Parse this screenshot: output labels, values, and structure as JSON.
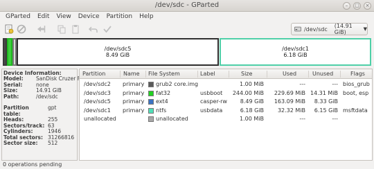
{
  "window": {
    "title": "/dev/sdc - GParted",
    "minimize": "–",
    "maximize": "▢",
    "close": "×"
  },
  "menu": [
    "GParted",
    "Edit",
    "View",
    "Device",
    "Partition",
    "Help"
  ],
  "toolbar": {
    "icons": [
      "new-partition-icon",
      "delete-icon",
      "resize-move-icon",
      "copy-icon",
      "paste-icon",
      "undo-icon",
      "apply-icon"
    ],
    "device": "/dev/sdc",
    "device_size": "(14.91 GiB)",
    "dropdown_arrow": "▼"
  },
  "partition_map": [
    {
      "name": "",
      "size": "",
      "border": "#3a3a3a",
      "fill": "#4a4a4a"
    },
    {
      "name": "",
      "size": "",
      "border": "#1fb81f",
      "fill": "#3fcf3f"
    },
    {
      "name": "",
      "size": "",
      "border": "#777777",
      "fill": "#dcdcdc"
    },
    {
      "name": "/dev/sdc5",
      "size": "8.49 GiB",
      "border": "#2f2f2f",
      "fill": "#ffffff"
    },
    {
      "name": "/dev/sdc1",
      "size": "6.18 GiB",
      "border": "#4fd0a8",
      "fill": "#ffffff"
    }
  ],
  "info": {
    "device_heading": "Device Information:",
    "device": [
      {
        "k": "Model:",
        "v": "SanDisk Cruzer Fit"
      },
      {
        "k": "Serial:",
        "v": "none"
      },
      {
        "k": "Size:",
        "v": "14.91 GiB"
      },
      {
        "k": "Path:",
        "v": "/dev/sdc"
      }
    ],
    "table": [
      {
        "k": "Partition table:",
        "v": "gpt"
      },
      {
        "k": "Heads:",
        "v": "255"
      },
      {
        "k": "Sectors/track:",
        "v": "63"
      },
      {
        "k": "Cylinders:",
        "v": "1946"
      },
      {
        "k": "Total sectors:",
        "v": "31266816"
      },
      {
        "k": "Sector size:",
        "v": "512"
      }
    ]
  },
  "table": {
    "columns": [
      "Partition",
      "Name",
      "File System",
      "Label",
      "Size",
      "Used",
      "Unused",
      "Flags"
    ],
    "rows": [
      {
        "partition": "/dev/sdc2",
        "name": "primary",
        "fs": "grub2 core.img",
        "color": "#5a5a5a",
        "label": "",
        "size": "1.00 MiB",
        "used": "---",
        "unused": "---",
        "flags": "bios_grub"
      },
      {
        "partition": "/dev/sdc3",
        "name": "primary",
        "fs": "fat32",
        "color": "#21d321",
        "label": "usbboot",
        "size": "244.00 MiB",
        "used": "229.69 MiB",
        "unused": "14.31 MiB",
        "flags": "boot, esp"
      },
      {
        "partition": "/dev/sdc5",
        "name": "primary",
        "fs": "ext4",
        "color": "#3b73c3",
        "label": "casper-rw",
        "size": "8.49 GiB",
        "used": "163.09 MiB",
        "unused": "8.33 GiB",
        "flags": ""
      },
      {
        "partition": "/dev/sdc1",
        "name": "primary",
        "fs": "ntfs",
        "color": "#4fe0b8",
        "label": "usbdata",
        "size": "6.18 GiB",
        "used": "32.32 MiB",
        "unused": "6.15 GiB",
        "flags": "msftdata"
      },
      {
        "partition": "unallocated",
        "name": "",
        "fs": "unallocated",
        "color": "#a8a8a8",
        "label": "",
        "size": "1.00 MiB",
        "used": "---",
        "unused": "---",
        "flags": ""
      }
    ]
  },
  "status": "0 operations pending"
}
